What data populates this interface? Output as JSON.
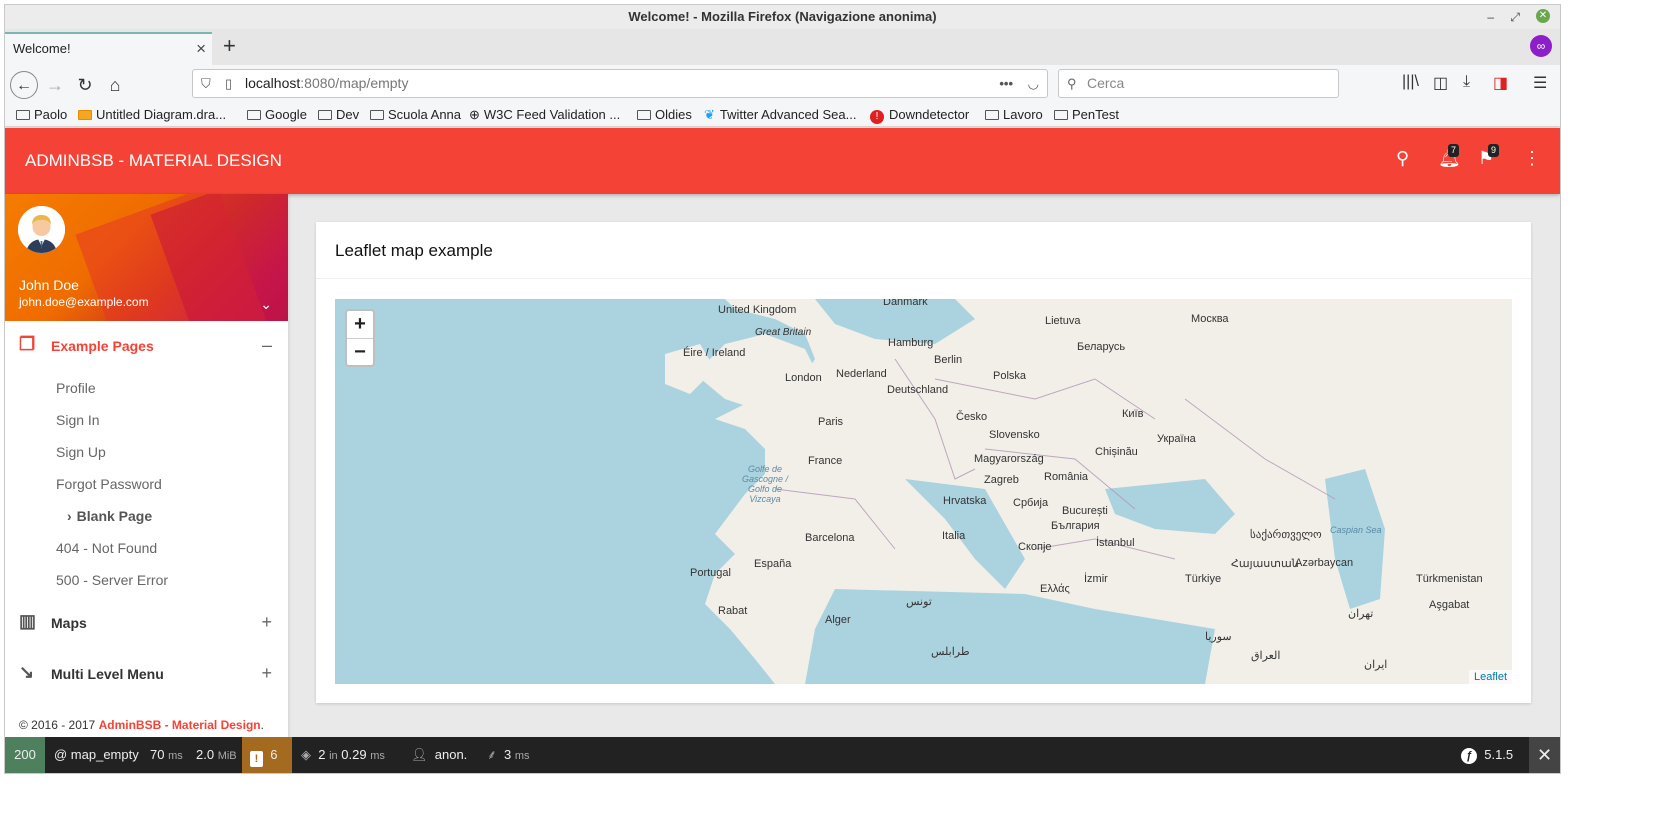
{
  "window": {
    "title": "Welcome! - Mozilla Firefox (Navigazione anonima)"
  },
  "tabs": [
    {
      "label": "Welcome!"
    }
  ],
  "nav": {
    "url_host": "localhost",
    "url_rest": ":8080/map/empty",
    "search_placeholder": "Cerca"
  },
  "bookmarks": [
    "Paolo",
    "Untitled Diagram.dra...",
    "Google",
    "Dev",
    "Scuola Anna",
    "W3C Feed Validation ...",
    "Oldies",
    "Twitter Advanced Sea...",
    "Downdetector",
    "Lavoro",
    "PenTest"
  ],
  "app": {
    "brand": "ADMINBSB - MATERIAL DESIGN",
    "notifications_count": "7",
    "flags_count": "9"
  },
  "user": {
    "name": "John Doe",
    "email": "john.doe@example.com"
  },
  "menu": {
    "example_pages": "Example Pages",
    "items": [
      "Profile",
      "Sign In",
      "Sign Up",
      "Forgot Password",
      "Blank Page",
      "404 - Not Found",
      "500 - Server Error"
    ],
    "maps": "Maps",
    "multi": "Multi Level Menu"
  },
  "footer": {
    "copyright": "© 2016 - 2017 ",
    "brand": "AdminBSB - Material Design",
    "dot": "."
  },
  "card": {
    "title": "Leaflet map example"
  },
  "map": {
    "zoom_in": "+",
    "zoom_out": "−",
    "attribution": "Leaflet",
    "labels": [
      "United Kingdom",
      "Danmark",
      "Lietuva",
      "Москва",
      "Great Britain",
      "Hamburg",
      "Беларусь",
      "Éire / Ireland",
      "Berlin",
      "Nederland",
      "Polska",
      "London",
      "Deutschland",
      "Česko",
      "Київ",
      "Paris",
      "Slovensko",
      "Україна",
      "France",
      "Magyarország",
      "Chișinău",
      "Zagreb",
      "România",
      "Hrvatska",
      "Србија",
      "București",
      "Barcelona",
      "Italia",
      "България",
      "Скопје",
      "İstanbul",
      "საქართველო",
      "Portugal",
      "España",
      "Ελλάς",
      "İzmir",
      "Türkiye",
      "Azərbaycan",
      "Rabat",
      "Alger",
      "Türkmenistan",
      "Aşgabat",
      "Golfe de Gascogne / Golfo de Vizcaya",
      "Caspian Sea",
      "Հայաստան",
      "تونس",
      "طرابلس",
      "تهران",
      "سوريا",
      "العراق",
      "ایران",
      "Caspian"
    ]
  },
  "debug": {
    "status": "200",
    "route": "@ map_empty",
    "time": "70",
    "time_unit": "ms",
    "mem": "2.0",
    "mem_unit": "MiB",
    "warn": "6",
    "db": "2",
    "db_in": "in",
    "db_time": "0.29",
    "db_unit": "ms",
    "user": "anon.",
    "twig": "3",
    "twig_unit": "ms",
    "version": "5.1.5"
  }
}
